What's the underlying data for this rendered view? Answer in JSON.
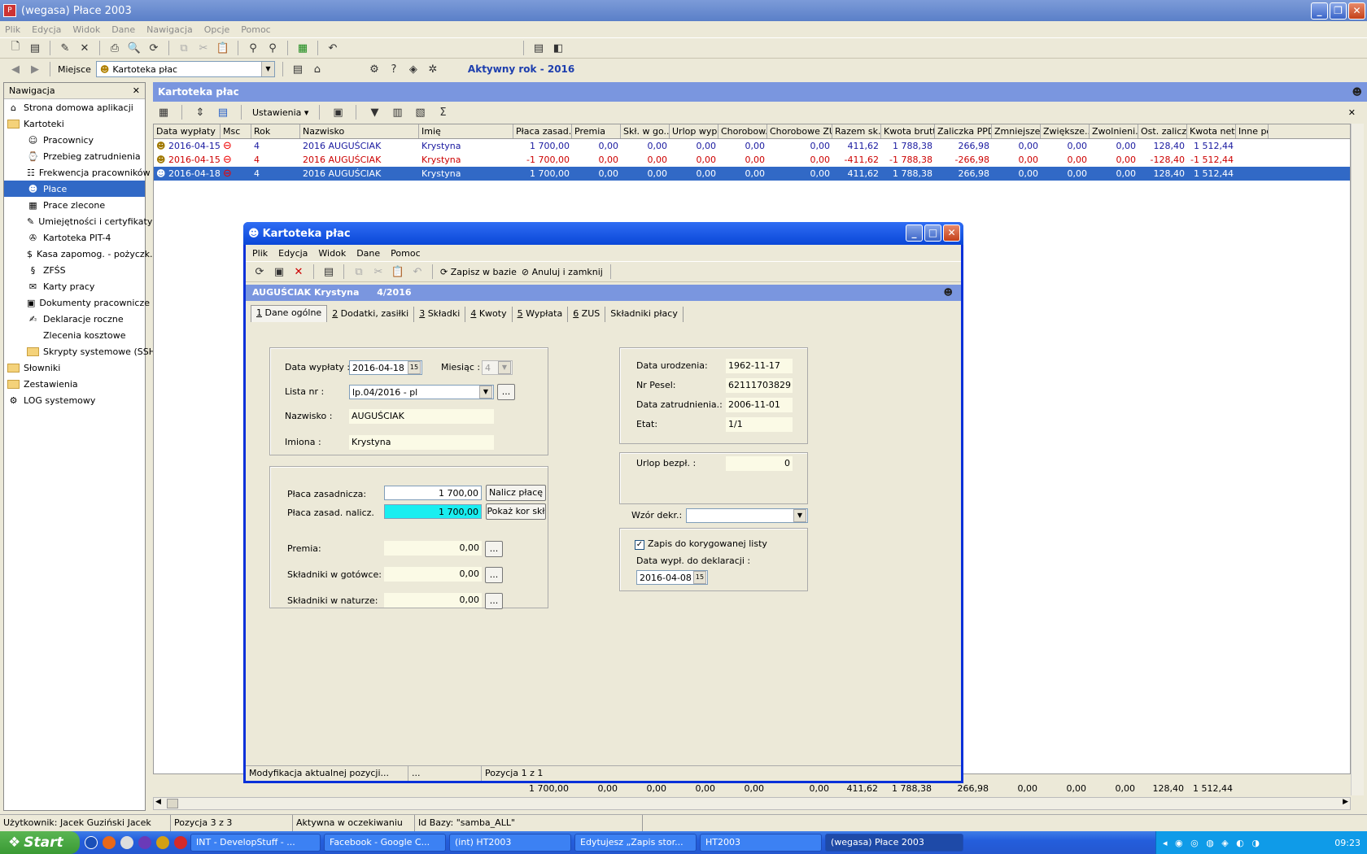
{
  "window": {
    "title": "(wegasa)  Płace 2003"
  },
  "menu": [
    "Plik",
    "Edycja",
    "Widok",
    "Dane",
    "Nawigacja",
    "Opcje",
    "Pomoc"
  ],
  "toolbar2": {
    "place_label": "Miejsce",
    "place_value": "Kartoteka płac",
    "active_year": "Aktywny rok - 2016"
  },
  "nav": {
    "title": "Nawigacja",
    "items": [
      {
        "label": "Strona domowa aplikacji",
        "icon": "home-icon",
        "indent": 0
      },
      {
        "label": "Kartoteki",
        "icon": "folder-icon",
        "indent": 0
      },
      {
        "label": "Pracownicy",
        "icon": "people-icon",
        "indent": 1
      },
      {
        "label": "Przebieg zatrudnienia",
        "icon": "history-icon",
        "indent": 1
      },
      {
        "label": "Frekwencja pracowników",
        "icon": "attendance-icon",
        "indent": 1
      },
      {
        "label": "Płace",
        "icon": "payroll-icon",
        "indent": 1,
        "selected": true
      },
      {
        "label": "Prace zlecone",
        "icon": "contract-icon",
        "indent": 1
      },
      {
        "label": "Umiejętności i certyfikaty",
        "icon": "certificate-icon",
        "indent": 1
      },
      {
        "label": "Kartoteka PIT-4",
        "icon": "pit-icon",
        "indent": 1
      },
      {
        "label": "Kasa zapomog. - pożyczk.",
        "icon": "money-bag-icon",
        "indent": 1
      },
      {
        "label": "ZFŚS",
        "icon": "zfss-icon",
        "indent": 1
      },
      {
        "label": "Karty pracy",
        "icon": "work-card-icon",
        "indent": 1
      },
      {
        "label": "Dokumenty pracownicze",
        "icon": "documents-icon",
        "indent": 1
      },
      {
        "label": "Deklaracje roczne",
        "icon": "declaration-icon",
        "indent": 1
      },
      {
        "label": "Zlecenia kosztowe",
        "icon": "",
        "indent": 1
      },
      {
        "label": "Skrypty systemowe (SSH)",
        "icon": "folder-icon",
        "indent": 1
      },
      {
        "label": "Słowniki",
        "icon": "folder-icon",
        "indent": 0
      },
      {
        "label": "Zestawienia",
        "icon": "folder-icon",
        "indent": 0
      },
      {
        "label": "LOG systemowy",
        "icon": "log-icon",
        "indent": 0
      }
    ]
  },
  "main": {
    "title": "Kartoteka płac",
    "settings_label": "Ustawienia",
    "columns": [
      "Data wypłaty",
      "Msc",
      "Rok",
      "Nazwisko",
      "Imię",
      "Płaca zasad.",
      "Premia",
      "Skł. w go...",
      "Urlop wyp...",
      "Chorobow...",
      "Chorobowe ZUS",
      "Razem sk...",
      "Kwota brutto",
      "Zaliczka PPD",
      "Zmniejsze...",
      "Zwiększe...",
      "Zwolnieni...",
      "Ost. zalicz...",
      "Kwota netto",
      "Inne pot"
    ],
    "rows": [
      {
        "style": "blue",
        "cells": [
          "2016-04-15",
          "",
          "4",
          "2016 AUGUŚCIAK",
          "Krystyna",
          "1 700,00",
          "0,00",
          "0,00",
          "0,00",
          "0,00",
          "0,00",
          "411,62",
          "1 788,38",
          "266,98",
          "0,00",
          "0,00",
          "0,00",
          "128,40",
          "1 512,44",
          ""
        ]
      },
      {
        "style": "red",
        "cells": [
          "2016-04-15",
          "",
          "4",
          "2016 AUGUŚCIAK",
          "Krystyna",
          "-1 700,00",
          "0,00",
          "0,00",
          "0,00",
          "0,00",
          "0,00",
          "-411,62",
          "-1 788,38",
          "-266,98",
          "0,00",
          "0,00",
          "0,00",
          "-128,40",
          "-1 512,44",
          ""
        ]
      },
      {
        "style": "sel",
        "cells": [
          "2016-04-18",
          "",
          "4",
          "2016 AUGUŚCIAK",
          "Krystyna",
          "1 700,00",
          "0,00",
          "0,00",
          "0,00",
          "0,00",
          "0,00",
          "411,62",
          "1 788,38",
          "266,98",
          "0,00",
          "0,00",
          "0,00",
          "128,40",
          "1 512,44",
          ""
        ]
      }
    ],
    "totals": [
      "1 700,00",
      "0,00",
      "0,00",
      "0,00",
      "0,00",
      "0,00",
      "411,62",
      "1 788,38",
      "266,98",
      "0,00",
      "0,00",
      "0,00",
      "128,40",
      "1 512,44"
    ]
  },
  "dialog": {
    "title": "Kartoteka płac",
    "menu": [
      "Plik",
      "Edycja",
      "Widok",
      "Dane",
      "Pomoc"
    ],
    "save_label": "Zapisz w bazie",
    "cancel_label": "Anuluj i zamknij",
    "header_name": "AUGUŚCIAK Krystyna",
    "header_period": "4/2016",
    "tabs": [
      {
        "key": "1",
        "label": " Dane ogólne"
      },
      {
        "key": "2",
        "label": " Dodatki, zasiłki"
      },
      {
        "key": "3",
        "label": " Składki"
      },
      {
        "key": "4",
        "label": " Kwoty"
      },
      {
        "key": "5",
        "label": " Wypłata"
      },
      {
        "key": "6",
        "label": " ZUS"
      },
      {
        "key": "",
        "label": "Składniki płacy"
      }
    ],
    "data_wyplaty_label": "Data wypłaty :",
    "data_wyplaty": "2016-04-18",
    "miesiac_label": "Miesiąc :",
    "miesiac": "4",
    "lista_label": "Lista nr :",
    "lista": "lp.04/2016 - pl",
    "nazwisko_label": "Nazwisko :",
    "nazwisko": "AUGUŚCIAK",
    "imiona_label": "Imiona :",
    "imiona": "Krystyna",
    "placa_zas_label": "Płaca zasadnicza:",
    "placa_zas": "1 700,00",
    "nalicz_label": "Nalicz płacę",
    "placa_nalicz_label": "Płaca zasad. nalicz.",
    "placa_nalicz": "1 700,00",
    "pokaz_label": "Pokaż kor skł",
    "premia_label": "Premia:",
    "premia": "0,00",
    "gotowce_label": "Składniki w gotówce:",
    "gotowce": "0,00",
    "naturze_label": "Składniki w naturze:",
    "naturze": "0,00",
    "urodzenia_label": "Data urodzenia:",
    "urodzenia": "1962-11-17",
    "pesel_label": "Nr Pesel:",
    "pesel": "62111703829",
    "zatrudnienia_label": "Data zatrudnienia.:",
    "zatrudnienia": "2006-11-01",
    "etat_label": "Etat:",
    "etat": "1/1",
    "urlop_label": "Urlop bezpł. :",
    "urlop": "0",
    "wzor_label": "Wzór dekr.:",
    "zapis_label": "Zapis do korygowanej listy",
    "data_dekl_label": "Data wypł. do deklaracji :",
    "data_dekl": "2016-04-08",
    "status_text": "Modyfikacja aktualnej pozycji...",
    "status_dots": "...",
    "status_pos": "Pozycja 1 z 1"
  },
  "status": {
    "user": "Użytkownik: Jacek Guziński Jacek",
    "pos": "Pozycja 3 z 3",
    "state": "Aktywna w oczekiwaniu",
    "db": "Id Bazy: \"samba_ALL\""
  },
  "taskbar": {
    "start": "Start",
    "tasks": [
      "INT - DevelopStuff - ...",
      "Facebook - Google C...",
      "(int)  HT2003",
      "Edytujesz „Zapis stor...",
      "HT2003",
      "(wegasa)  Płace 2003"
    ],
    "clock": "09:23"
  }
}
